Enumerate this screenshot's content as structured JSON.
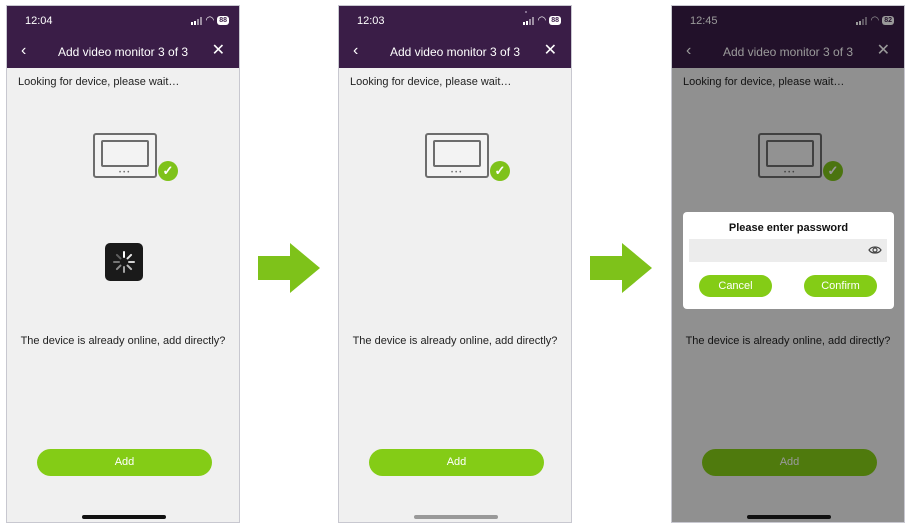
{
  "colors": {
    "header_bg": "#3a1d47",
    "accent_green": "#84cc16",
    "check_green": "#7ec21a",
    "screen_bg": "#f0f0f0",
    "arrow_green": "#7ec21a"
  },
  "screens": [
    {
      "status": {
        "time": "12:04",
        "battery": "88"
      },
      "header": {
        "back_icon": "chevron-left-icon",
        "title": "Add video monitor 3 of 3",
        "close_icon": "close-icon"
      },
      "looking_text": "Looking for device, please wait…",
      "device_found": true,
      "loading": true,
      "question": "The device is already online, add directly?",
      "add_label": "Add"
    },
    {
      "status": {
        "time": "12:03",
        "battery": "88"
      },
      "header": {
        "back_icon": "chevron-left-icon",
        "title": "Add video monitor 3 of 3",
        "close_icon": "close-icon"
      },
      "looking_text": "Looking for device, please wait…",
      "device_found": true,
      "question": "The device is already online, add directly?",
      "add_label": "Add"
    },
    {
      "status": {
        "time": "12:45",
        "battery": "82"
      },
      "header": {
        "back_icon": "chevron-left-icon",
        "title": "Add video monitor 3 of 3",
        "close_icon": "close-icon"
      },
      "looking_text": "Looking for device, please wait…",
      "device_found": true,
      "question": "The device is already online, add directly?",
      "add_label": "Add",
      "dialog": {
        "title": "Please enter password",
        "password_value": "",
        "password_placeholder": "",
        "show_password_icon": "eye-icon",
        "cancel_label": "Cancel",
        "confirm_label": "Confirm"
      }
    }
  ],
  "flow_arrows": [
    "arrow-right-icon",
    "arrow-right-icon"
  ]
}
